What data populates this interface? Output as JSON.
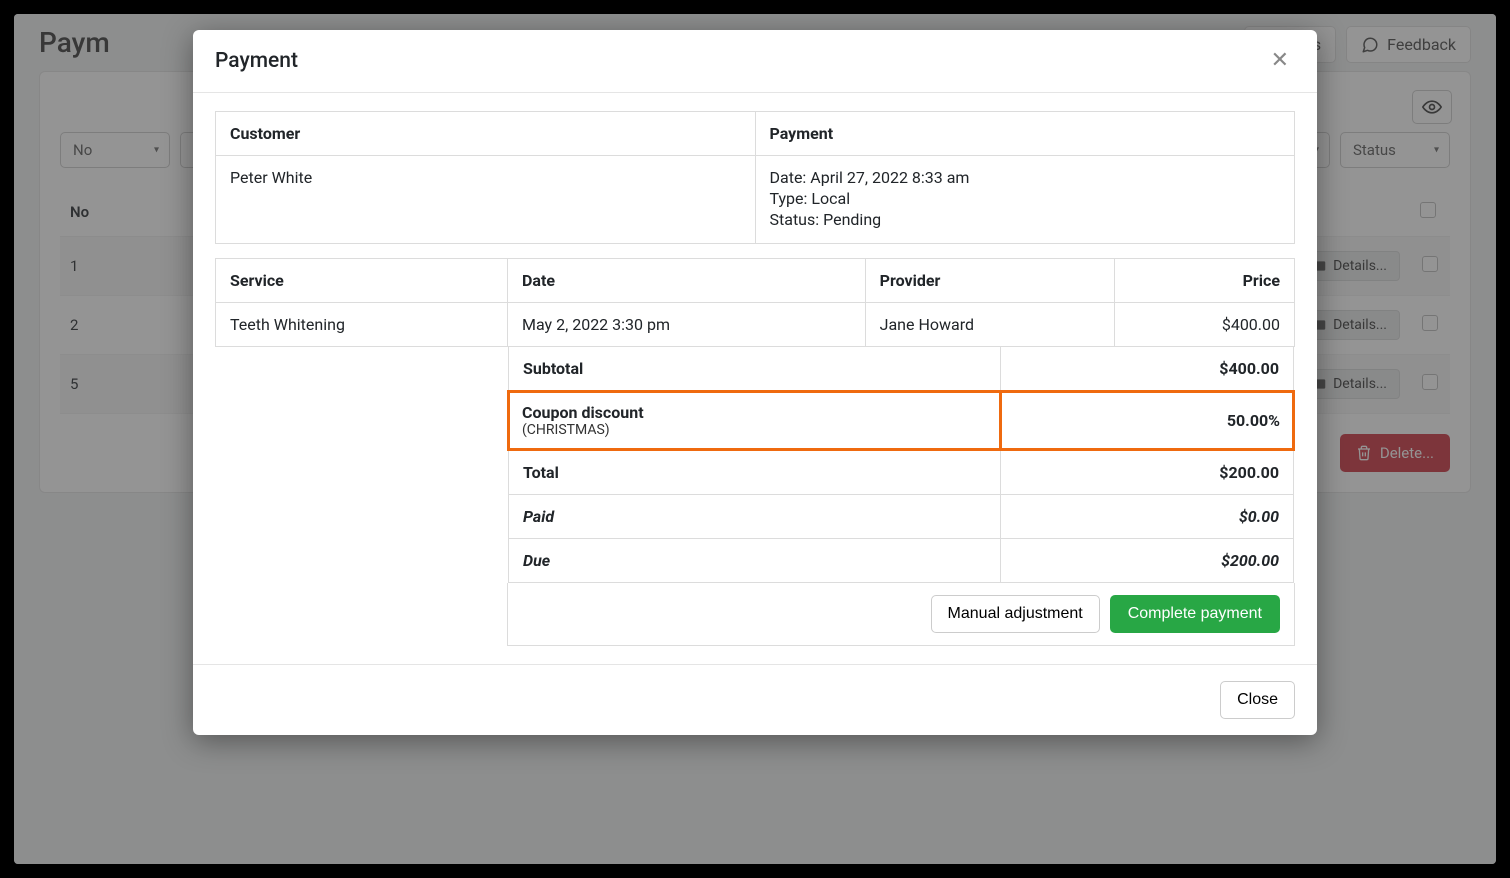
{
  "page": {
    "title": "Paym"
  },
  "header": {
    "requests": "requests",
    "feedback": "Feedback"
  },
  "filters": {
    "first": "No",
    "status": "Status"
  },
  "bgTable": {
    "headers": {
      "no": "No"
    },
    "rows": [
      {
        "no": "1",
        "details": "Details..."
      },
      {
        "no": "2",
        "details": "Details..."
      },
      {
        "no": "5",
        "details": "Details..."
      }
    ]
  },
  "deleteBtn": "Delete...",
  "modal": {
    "title": "Payment",
    "customerHeader": "Customer",
    "paymentHeader": "Payment",
    "customerName": "Peter White",
    "payment": {
      "dateLabel": "Date:",
      "dateValue": "April 27, 2022 8:33 am",
      "typeLabel": "Type:",
      "typeValue": "Local",
      "statusLabel": "Status:",
      "statusValue": "Pending"
    },
    "svcHeaders": {
      "service": "Service",
      "date": "Date",
      "provider": "Provider",
      "price": "Price"
    },
    "svcRow": {
      "service": "Teeth Whitening",
      "date": "May 2, 2022 3:30 pm",
      "provider": "Jane Howard",
      "price": "$400.00"
    },
    "summary": {
      "subtotalLabel": "Subtotal",
      "subtotalValue": "$400.00",
      "couponLabel": "Coupon discount",
      "couponCode": "(CHRISTMAS)",
      "couponValue": "50.00%",
      "totalLabel": "Total",
      "totalValue": "$200.00",
      "paidLabel": "Paid",
      "paidValue": "$0.00",
      "dueLabel": "Due",
      "dueValue": "$200.00"
    },
    "manualBtn": "Manual adjustment",
    "completeBtn": "Complete payment",
    "closeBtn": "Close"
  }
}
